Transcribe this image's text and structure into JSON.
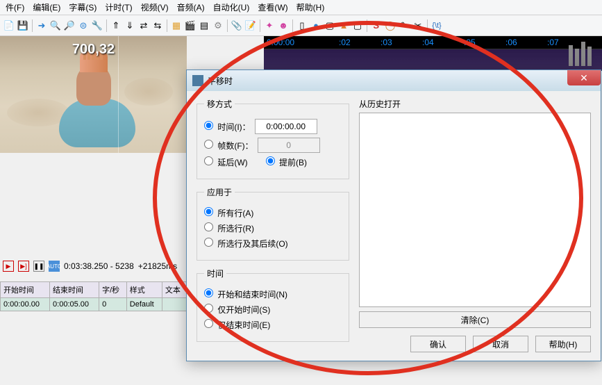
{
  "menu": {
    "file": "件(F)",
    "edit": "编辑(E)",
    "subtitle": "字幕(S)",
    "timing": "计时(T)",
    "video": "视频(V)",
    "audio": "音频(A)",
    "automation": "自动化(U)",
    "view": "查看(W)",
    "help": "帮助(H)"
  },
  "toolbar_icons": [
    "📄",
    "💾",
    "|",
    "➜",
    "🔍",
    "🔎",
    "🌐",
    "🔧",
    "|",
    "⏫",
    "⏬",
    "🔀",
    "🔀",
    "|",
    "📊",
    "🎬",
    "📋",
    "⚙",
    "|",
    "📎",
    "📝",
    "|",
    "📐",
    "👤",
    "|",
    "📑",
    "🔵",
    "⬜",
    "🔺",
    "⬜",
    "|",
    "S",
    "⭕",
    "✏",
    "🔧",
    "|",
    "{\\t}"
  ],
  "video": {
    "overlay_time": "700,32"
  },
  "timeline": {
    "marks": [
      "0:00:00",
      ":02",
      ":03",
      ":04",
      ":05",
      ":06",
      ":07"
    ]
  },
  "status": {
    "time": "0:03:38.250 - 5238",
    "offset": "+21825"
  },
  "grid": {
    "headers": {
      "start": "开始时间",
      "end": "结束时间",
      "cps": "字/秒",
      "style": "样式",
      "text": "文本"
    },
    "row": {
      "start": "0:00:00.00",
      "end": "0:00:05.00",
      "cps": "0",
      "style": "Default",
      "text": ""
    }
  },
  "dialog": {
    "title": "平移时",
    "shift_method": {
      "legend": "移方式",
      "time_label": "时间(I)：",
      "time_value": "0:00:00.00",
      "frames_label": "帧数(F)：",
      "frames_value": "0",
      "delay_label": "延后(W)",
      "advance_label": "提前(B)"
    },
    "apply_to": {
      "legend": "应用于",
      "all": "所有行(A)",
      "selected": "所选行(R)",
      "selected_onward": "所选行及其后续(O)"
    },
    "time_section": {
      "legend": "时间",
      "both": "开始和结束时间(N)",
      "start_only": "仅开始时间(S)",
      "end_only": "仅结束时间(E)"
    },
    "history": {
      "label": "从历史打开",
      "clear": "清除(C)"
    },
    "buttons": {
      "ok": "确认",
      "cancel": "取消",
      "help": "帮助(H)"
    }
  }
}
